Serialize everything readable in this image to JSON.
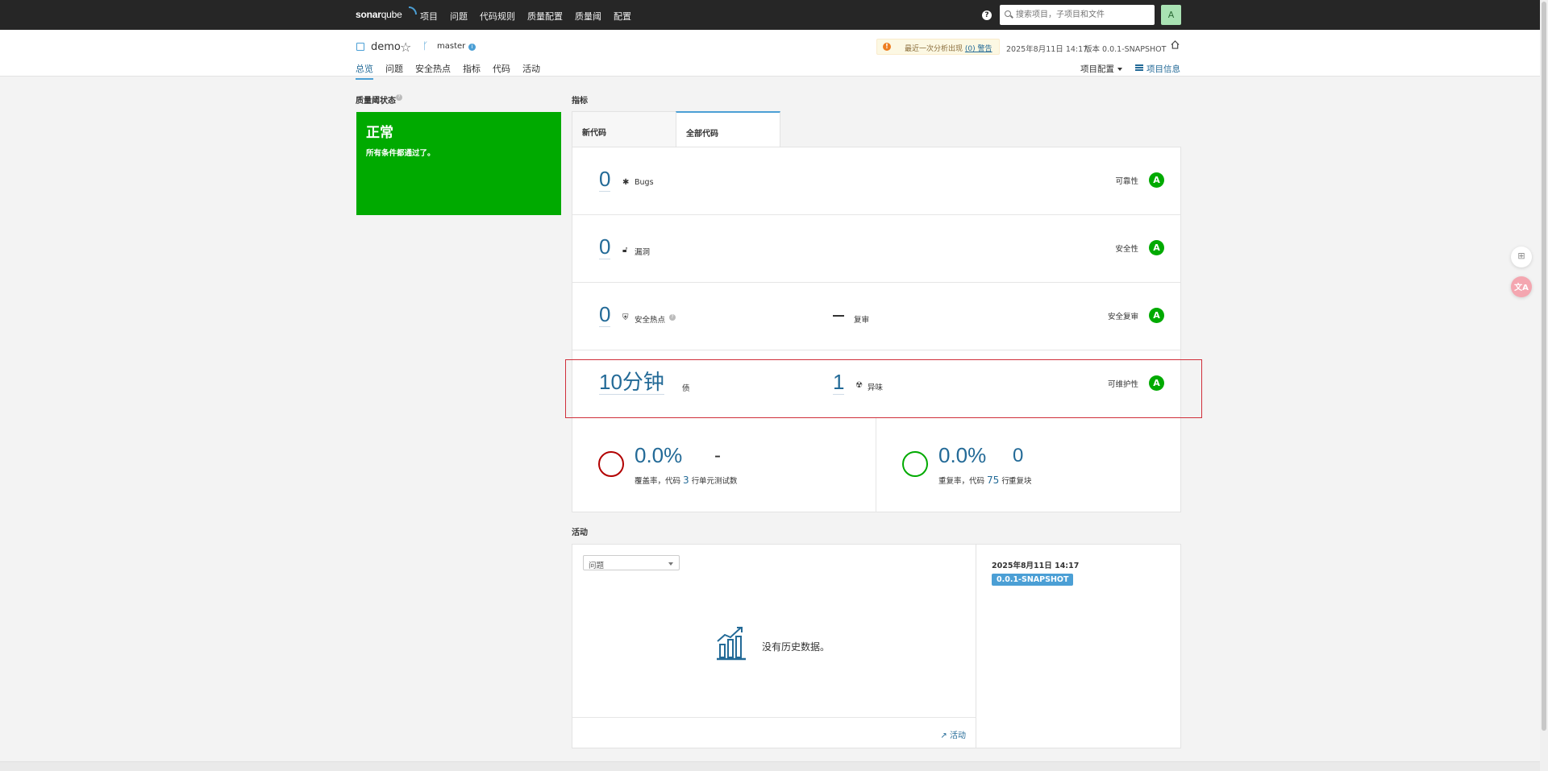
{
  "topbar": {
    "logo_a": "sonar",
    "logo_b": "qube",
    "nav": [
      "项目",
      "问题",
      "代码规则",
      "质量配置",
      "质量阈",
      "配置"
    ],
    "search_placeholder": "搜索项目，子项目和文件",
    "avatar": "A"
  },
  "project": {
    "name": "demo",
    "branch": "master",
    "warning_text": "最近一次分析出现",
    "warning_link": "(0) 警告",
    "analysis_date": "2025年8月11日 14:17",
    "version": "版本 0.0.1-SNAPSHOT",
    "tabs": [
      "总览",
      "问题",
      "安全热点",
      "指标",
      "代码",
      "活动"
    ],
    "config": "项目配置",
    "info": "项目信息"
  },
  "quality_gate": {
    "label": "质量阈状态",
    "status": "正常",
    "desc": "所有条件都通过了。"
  },
  "metrics": {
    "label": "指标",
    "tab_new": "新代码",
    "tab_all": "全部代码",
    "rows": [
      {
        "value": "0",
        "label": "Bugs",
        "rating_label": "可靠性",
        "rating": "A"
      },
      {
        "value": "0",
        "label": "漏洞",
        "rating_label": "安全性",
        "rating": "A"
      },
      {
        "value": "0",
        "label": "安全热点",
        "mid_label": "复审",
        "rating_label": "安全复审",
        "rating": "A"
      },
      {
        "value": "10分钟",
        "label": "债",
        "mid_value": "1",
        "mid_label": "异味",
        "rating_label": "可维护性",
        "rating": "A"
      }
    ],
    "coverage": {
      "pct": "0.0%",
      "label_pre": "覆盖率，代码",
      "lines": "3",
      "label_post": "行",
      "tests_value": "-",
      "tests_label": "单元测试数",
      "ring_color": "#b20000"
    },
    "duplication": {
      "pct": "0.0%",
      "label_pre": "重复率，代码",
      "lines": "75",
      "label_post": "行",
      "blocks_value": "0",
      "blocks_label": "重复块",
      "ring_color": "#00aa00"
    }
  },
  "activity": {
    "label": "活动",
    "select": "问题",
    "no_history": "没有历史数据。",
    "link": "活动",
    "date": "2025年8月11日 14:17",
    "version_badge": "0.0.1-SNAPSHOT"
  }
}
